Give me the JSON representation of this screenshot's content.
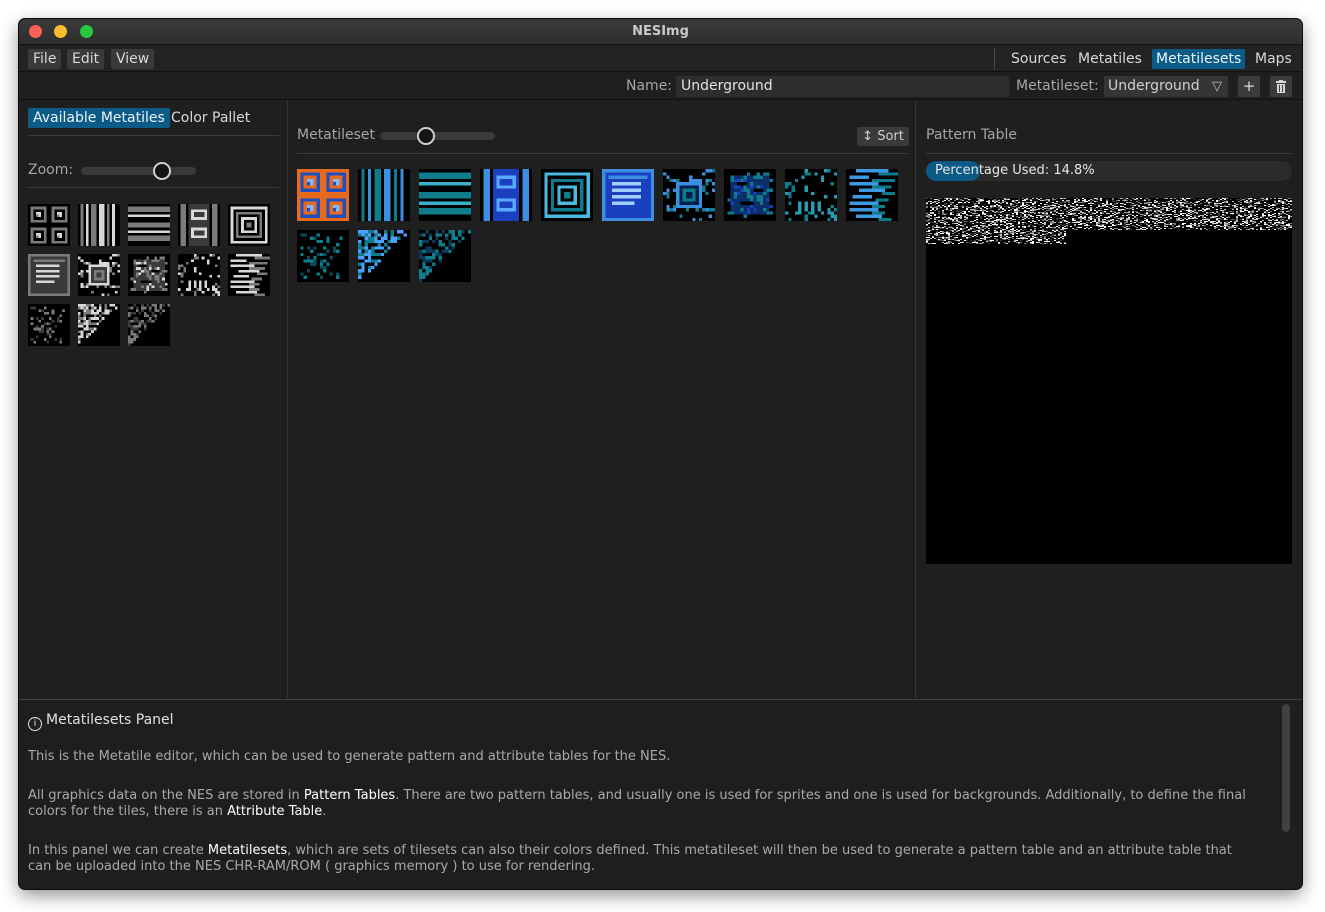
{
  "window": {
    "title": "NESImg"
  },
  "menu": {
    "file": "File",
    "edit": "Edit",
    "view": "View"
  },
  "nav": {
    "sources": "Sources",
    "metatiles": "Metatiles",
    "metatilesets": "Metatilesets",
    "maps": "Maps",
    "active": "Metatilesets"
  },
  "namebar": {
    "name_label": "Name:",
    "name_value": "Underground",
    "metatileset_label": "Metatileset:",
    "metatileset_value": "Underground",
    "add_icon": "plus-icon",
    "delete_icon": "trash-icon"
  },
  "left_panel": {
    "tab_available": "Available Metatiles",
    "tab_color": "Color Pallet",
    "zoom_label": "Zoom:",
    "zoom_level": 0.7,
    "tiles": [
      "quad-squares",
      "vertical-stripes",
      "horizontal-stripes",
      "pillar",
      "spiral",
      "vent",
      "block-square",
      "boulder",
      "skull-face",
      "rock-streaks",
      "speckle",
      "cave-slope-left",
      "cave-slope-right"
    ]
  },
  "mid_panel": {
    "title": "Metatileset",
    "slider_level": 0.4,
    "sort_label": "Sort",
    "sort_icon": "sort-updown-icon",
    "tiles": [
      "quad-squares",
      "vertical-stripes",
      "horizontal-stripes",
      "pillar",
      "spiral",
      "vent",
      "block-square",
      "boulder",
      "skull-face",
      "rock-streaks",
      "speckle",
      "cave-slope-left",
      "cave-slope-right"
    ],
    "colors": {
      "blue": "#3c8fe0",
      "dark_blue": "#1a3fbf",
      "teal": "#0f7c8c",
      "orange": "#e86a1c"
    }
  },
  "right_panel": {
    "title": "Pattern Table",
    "percentage_text": "Percentage Used: 14.8%",
    "percentage_used": 14.8
  },
  "info": {
    "icon": "info-icon",
    "title": "Metatilesets Panel",
    "p1": "This is the Metatile editor, which can be used to generate pattern and attribute tables for the NES.",
    "p2_a": "All graphics data on the NES are stored in ",
    "p2_b": "Pattern Tables",
    "p2_c": ". There are two pattern tables, and usually one is used for sprites and one is used for backgrounds. Additionally, to define the final colors for the tiles, there is an ",
    "p2_d": "Attribute Table",
    "p2_e": ".",
    "p3_a": "In this panel we can create ",
    "p3_b": "Metatilesets",
    "p3_c": ", which are sets of tilesets can also their colors defined. This metatileset will then be used to generate a pattern table and an attribute table that can be uploaded into the NES CHR-RAM/ROM ( graphics memory ) to use for rendering."
  }
}
